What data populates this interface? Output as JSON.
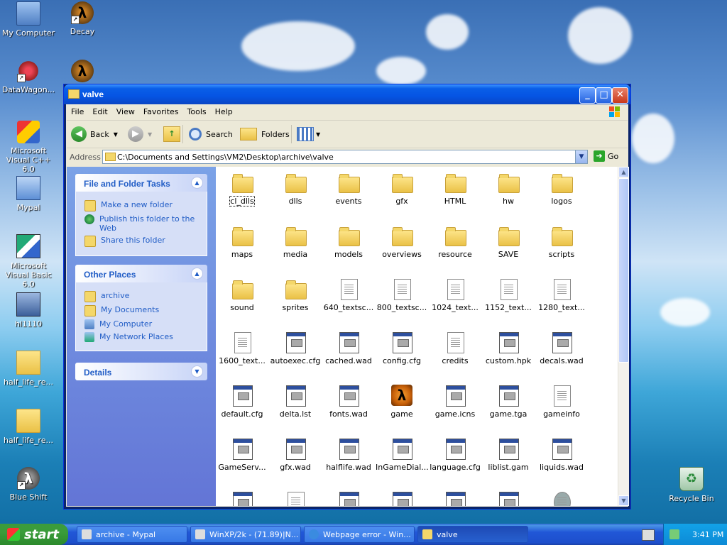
{
  "desktop": {
    "icons": [
      {
        "label": "My Computer"
      },
      {
        "label": "Decay"
      },
      {
        "label": "DataWagon..."
      },
      {
        "label": "Microsoft Visual C++ 6.0"
      },
      {
        "label": "Mypal"
      },
      {
        "label": "Microsoft Visual Basic 6.0"
      },
      {
        "label": "hl1110"
      },
      {
        "label": "half_life_re..."
      },
      {
        "label": "half_life_re..."
      },
      {
        "label": "Blue Shift"
      },
      {
        "label": "Recycle Bin"
      }
    ]
  },
  "window": {
    "title": "valve",
    "minimize": "_",
    "maximize": "□",
    "close": "✕",
    "menu": [
      "File",
      "Edit",
      "View",
      "Favorites",
      "Tools",
      "Help"
    ],
    "toolbar": {
      "back_label": "Back",
      "search_label": "Search",
      "folders_label": "Folders"
    },
    "address": {
      "label": "Address",
      "path": "C:\\Documents and Settings\\VM2\\Desktop\\archive\\valve",
      "go_label": "Go"
    },
    "tasks": {
      "file_folder": {
        "title": "File and Folder Tasks",
        "links": [
          "Make a new folder",
          "Publish this folder to the Web",
          "Share this folder"
        ]
      },
      "other_places": {
        "title": "Other Places",
        "links": [
          "archive",
          "My Documents",
          "My Computer",
          "My Network Places"
        ]
      },
      "details": {
        "title": "Details"
      }
    },
    "files": [
      {
        "name": "cl_dlls",
        "type": "folder"
      },
      {
        "name": "dlls",
        "type": "folder"
      },
      {
        "name": "events",
        "type": "folder"
      },
      {
        "name": "gfx",
        "type": "folder"
      },
      {
        "name": "HTML",
        "type": "folder"
      },
      {
        "name": "hw",
        "type": "folder"
      },
      {
        "name": "logos",
        "type": "folder"
      },
      {
        "name": "maps",
        "type": "folder"
      },
      {
        "name": "media",
        "type": "folder"
      },
      {
        "name": "models",
        "type": "folder"
      },
      {
        "name": "overviews",
        "type": "folder"
      },
      {
        "name": "resource",
        "type": "folder"
      },
      {
        "name": "SAVE",
        "type": "folder"
      },
      {
        "name": "scripts",
        "type": "folder"
      },
      {
        "name": "sound",
        "type": "folder"
      },
      {
        "name": "sprites",
        "type": "folder"
      },
      {
        "name": "640_textsc...",
        "type": "doc"
      },
      {
        "name": "800_textsc...",
        "type": "doc"
      },
      {
        "name": "1024_text...",
        "type": "doc"
      },
      {
        "name": "1152_text...",
        "type": "doc"
      },
      {
        "name": "1280_text...",
        "type": "doc"
      },
      {
        "name": "1600_text...",
        "type": "doc"
      },
      {
        "name": "autoexec.cfg",
        "type": "cfg"
      },
      {
        "name": "cached.wad",
        "type": "cfg"
      },
      {
        "name": "config.cfg",
        "type": "cfg"
      },
      {
        "name": "credits",
        "type": "doc"
      },
      {
        "name": "custom.hpk",
        "type": "cfg"
      },
      {
        "name": "decals.wad",
        "type": "cfg"
      },
      {
        "name": "default.cfg",
        "type": "cfg"
      },
      {
        "name": "delta.lst",
        "type": "cfg"
      },
      {
        "name": "fonts.wad",
        "type": "cfg"
      },
      {
        "name": "game",
        "type": "lambda"
      },
      {
        "name": "game.icns",
        "type": "cfg"
      },
      {
        "name": "game.tga",
        "type": "cfg"
      },
      {
        "name": "gameinfo",
        "type": "doc"
      },
      {
        "name": "GameServ...",
        "type": "cfg"
      },
      {
        "name": "gfx.wad",
        "type": "cfg"
      },
      {
        "name": "halflife.wad",
        "type": "cfg"
      },
      {
        "name": "InGameDial...",
        "type": "cfg"
      },
      {
        "name": "language.cfg",
        "type": "cfg"
      },
      {
        "name": "liblist.gam",
        "type": "cfg"
      },
      {
        "name": "liquids.wad",
        "type": "cfg"
      },
      {
        "name": "",
        "type": "cfg"
      },
      {
        "name": "",
        "type": "doc"
      },
      {
        "name": "",
        "type": "cfg"
      },
      {
        "name": "",
        "type": "cfg"
      },
      {
        "name": "",
        "type": "cfg"
      },
      {
        "name": "",
        "type": "cfg"
      },
      {
        "name": "",
        "type": "raccoon"
      }
    ]
  },
  "taskbar": {
    "start_label": "start",
    "buttons": [
      {
        "label": "archive - Mypal"
      },
      {
        "label": "WinXP/2k - (71.89)|N..."
      },
      {
        "label": "Webpage error - Win..."
      },
      {
        "label": "valve"
      }
    ],
    "clock": "3:41 PM"
  }
}
